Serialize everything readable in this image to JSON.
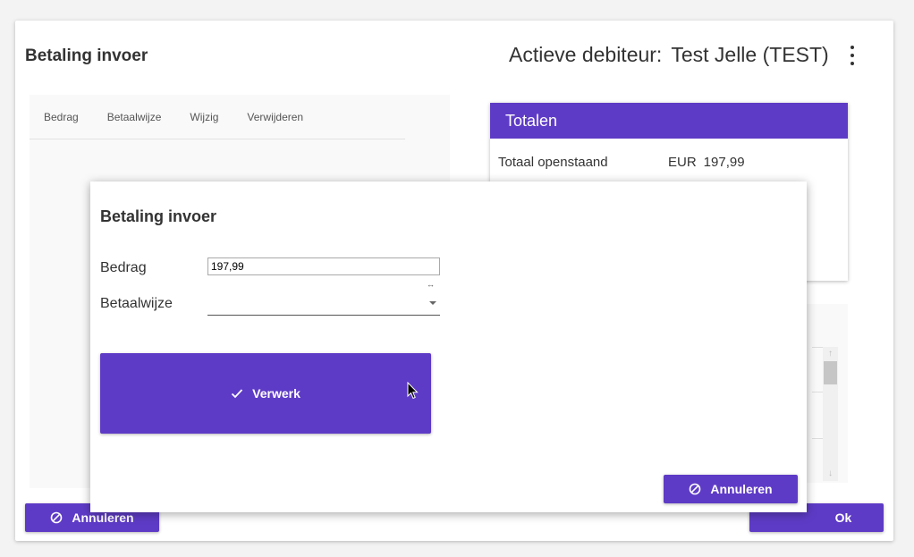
{
  "main": {
    "title": "Betaling invoer",
    "debtor_label": "Actieve debiteur:",
    "debtor_name": "Test Jelle (TEST)",
    "table_headers": [
      "Bedrag",
      "Betaalwijze",
      "Wijzig",
      "Verwijderen"
    ]
  },
  "totals": {
    "header": "Totalen",
    "label": "Totaal openstaand",
    "currency": "EUR",
    "amount": "197,99"
  },
  "footer": {
    "cancel_label": "Annuleren",
    "ok_label": "Ok"
  },
  "dialog": {
    "title": "Betaling invoer",
    "bedrag_label": "Bedrag",
    "bedrag_value": "197,99",
    "betaalwijze_label": "Betaalwijze",
    "betaalwijze_value": "",
    "verwerk_label": "Verwerk",
    "annuleren_label": "Annuleren"
  },
  "colors": {
    "accent": "#5e3bc6"
  },
  "icons": {
    "kebab": "more-vert-icon",
    "check": "check-icon",
    "cancel": "block-icon",
    "dropdown": "caret-down-icon",
    "cursor": "mouse-pointer-icon"
  }
}
